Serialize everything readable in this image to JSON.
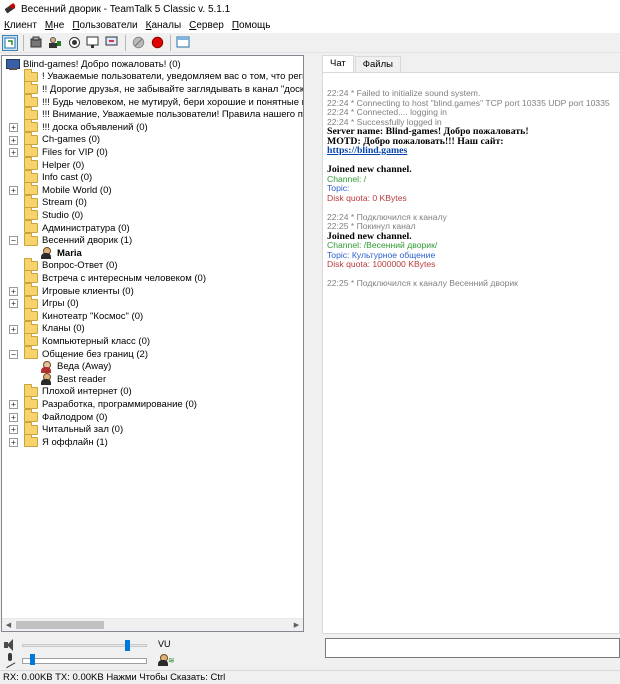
{
  "window": {
    "title": "Весенний дворик - TeamTalk 5 Classic v. 5.1.1"
  },
  "menu": [
    {
      "pre": "",
      "ul": "К",
      "post": "лиент"
    },
    {
      "pre": "",
      "ul": "М",
      "post": "не"
    },
    {
      "pre": "",
      "ul": "П",
      "post": "ользователи"
    },
    {
      "pre": "",
      "ul": "К",
      "post": "аналы"
    },
    {
      "pre": "",
      "ul": "С",
      "post": "ервер"
    },
    {
      "pre": "",
      "ul": "П",
      "post": "омощь"
    }
  ],
  "tree": {
    "server": "Blind-games! Добро пожаловать! (0)",
    "channels": [
      {
        "label": "! Уважаемые пользователи, уведомляем вас о том, что регистра",
        "has_children": false
      },
      {
        "label": "!! Дорогие друзья, не забывайте заглядывать в канал \"доска о",
        "has_children": false
      },
      {
        "label": "!!! Будь человеком, не мутируй, бери хорошие и понятные ники",
        "has_children": false
      },
      {
        "label": "!!! Внимание, Уважаемые пользователи! Правила нашего портал",
        "has_children": false
      },
      {
        "label": "!!! доска объявлений (0)",
        "has_children": true
      },
      {
        "label": "Ch-games (0)",
        "has_children": true
      },
      {
        "label": "Files for VIP (0)",
        "has_children": true
      },
      {
        "label": "Helper (0)",
        "has_children": false
      },
      {
        "label": "Info cast (0)",
        "has_children": false
      },
      {
        "label": "Mobile World (0)",
        "has_children": true
      },
      {
        "label": "Stream (0)",
        "has_children": false
      },
      {
        "label": "Studio (0)",
        "has_children": false
      },
      {
        "label": "Администратура (0)",
        "has_children": false
      },
      {
        "label": "Весенний дворик (1)",
        "has_children": true,
        "expanded": true,
        "users": [
          {
            "name": "Maria",
            "bold": true,
            "away": false
          }
        ]
      },
      {
        "label": "Вопрос-Ответ (0)",
        "has_children": false
      },
      {
        "label": "Встреча с интересным человеком (0)",
        "has_children": false
      },
      {
        "label": "Игровые клиенты (0)",
        "has_children": true
      },
      {
        "label": "Игры (0)",
        "has_children": true
      },
      {
        "label": "Кинотеатр \"Космос\" (0)",
        "has_children": false
      },
      {
        "label": "Кланы (0)",
        "has_children": true
      },
      {
        "label": "Компьютерный класс (0)",
        "has_children": false
      },
      {
        "label": "Общение без границ (2)",
        "has_children": true,
        "expanded": true,
        "users": [
          {
            "name": "Веда  (Away)",
            "bold": false,
            "away": true
          },
          {
            "name": "Best reader",
            "bold": false,
            "away": false
          }
        ]
      },
      {
        "label": "Плохой интернет (0)",
        "has_children": false
      },
      {
        "label": "Разработка, программирование (0)",
        "has_children": true
      },
      {
        "label": "Файлодром (0)",
        "has_children": true
      },
      {
        "label": "Читальный зал (0)",
        "has_children": true
      },
      {
        "label": "Я оффлайн (1)",
        "has_children": true
      }
    ]
  },
  "tabs": [
    {
      "label": "Чат",
      "active": true
    },
    {
      "label": "Файлы",
      "active": false
    }
  ],
  "chat": [
    {
      "text": "22:24 * Failed to initialize sound system.",
      "style": "gray"
    },
    {
      "text": "22:24 * Connecting to host \"blind.games\" TCP port 10335 UDP port 10335",
      "style": "gray"
    },
    {
      "text": "22:24 * Connected.... logging in",
      "style": "gray"
    },
    {
      "text": "22:24 * Successfully logged in",
      "style": "gray"
    },
    {
      "text": "Server name: Blind-games! Добро пожаловать!",
      "style": "bold"
    },
    {
      "text": "MOTD: Добро пожаловать!!! Наш сайт:",
      "style": "bold"
    },
    {
      "text": "https://blind.games",
      "style": "link"
    },
    {
      "text": "",
      "style": "gap"
    },
    {
      "text": "Joined new channel.",
      "style": "bold"
    },
    {
      "text": "Channel: /",
      "style": "green"
    },
    {
      "text": "Topic:",
      "style": "blue"
    },
    {
      "text": "Disk quota: 0 KBytes",
      "style": "red"
    },
    {
      "text": "",
      "style": "gap"
    },
    {
      "text": "22:24 * Подключился к каналу",
      "style": "gray"
    },
    {
      "text": "22:25 * Покинул канал",
      "style": "gray"
    },
    {
      "text": "Joined new channel.",
      "style": "bold"
    },
    {
      "text": "Channel: /Весенний дворик/",
      "style": "green"
    },
    {
      "text": "Topic: Культурное общение",
      "style": "blue"
    },
    {
      "text": "Disk quota: 1000000 KBytes",
      "style": "red"
    },
    {
      "text": "",
      "style": "gap"
    },
    {
      "text": "22:25 * Подключился к каналу Весенний дворик",
      "style": "gray"
    }
  ],
  "volume": {
    "label": "VU",
    "master_level": 0.84,
    "mic_level": 0.08
  },
  "status": {
    "text": "RX: 0.00KB TX: 0.00KB Нажми Чтобы Сказать: Ctrl"
  }
}
